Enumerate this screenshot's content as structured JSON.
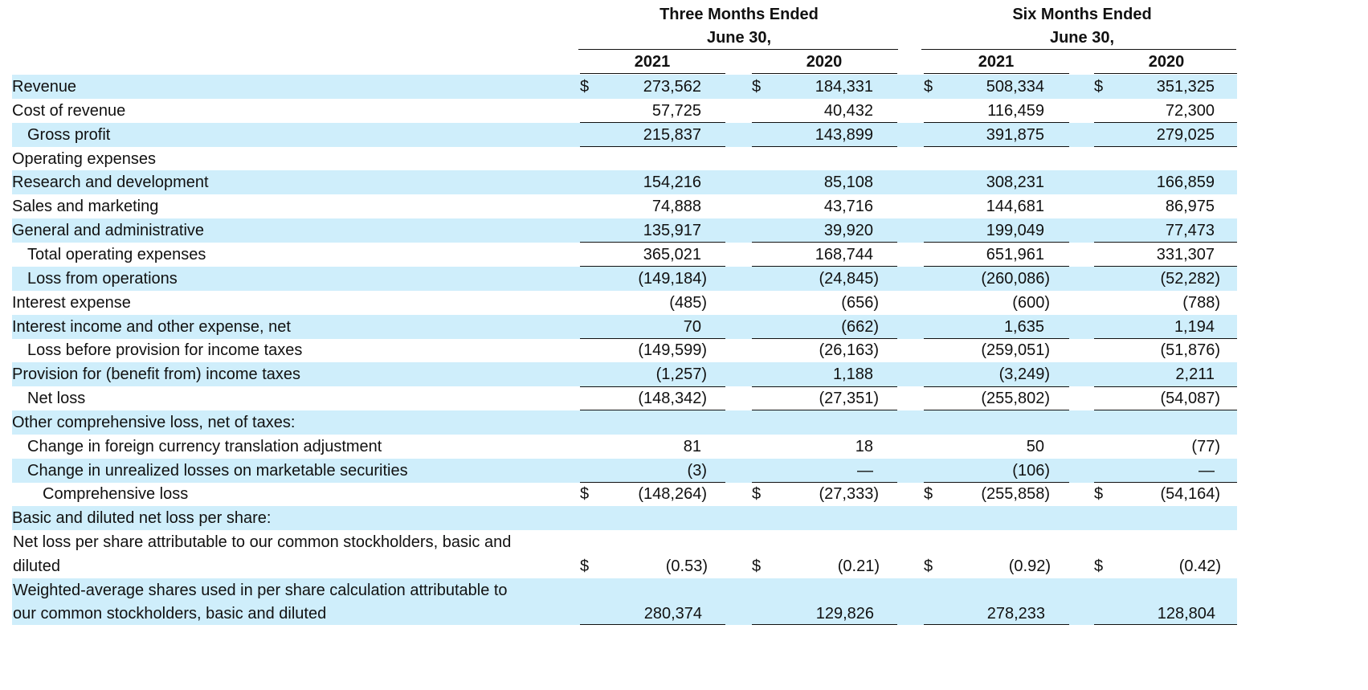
{
  "header": {
    "group1": [
      "Three Months Ended",
      "June 30,"
    ],
    "group2": [
      "Six Months Ended",
      "June 30,"
    ],
    "years": [
      "2021",
      "2020",
      "2021",
      "2020"
    ]
  },
  "currency_symbol": "$",
  "rows": [
    {
      "label": "Revenue",
      "values": [
        "273,562",
        "184,331",
        "508,334",
        "351,325"
      ]
    },
    {
      "label": "Cost of revenue",
      "values": [
        "57,725",
        "40,432",
        "116,459",
        "72,300"
      ]
    },
    {
      "label": "Gross profit",
      "values": [
        "215,837",
        "143,899",
        "391,875",
        "279,025"
      ]
    },
    {
      "label": "Operating expenses",
      "values": [
        "",
        "",
        "",
        ""
      ]
    },
    {
      "label": "Research and development",
      "values": [
        "154,216",
        "85,108",
        "308,231",
        "166,859"
      ]
    },
    {
      "label": "Sales and marketing",
      "values": [
        "74,888",
        "43,716",
        "144,681",
        "86,975"
      ]
    },
    {
      "label": "General and administrative",
      "values": [
        "135,917",
        "39,920",
        "199,049",
        "77,473"
      ]
    },
    {
      "label": "Total operating expenses",
      "values": [
        "365,021",
        "168,744",
        "651,961",
        "331,307"
      ]
    },
    {
      "label": "Loss from operations",
      "values": [
        "(149,184)",
        "(24,845)",
        "(260,086)",
        "(52,282)"
      ]
    },
    {
      "label": "Interest expense",
      "values": [
        "(485)",
        "(656)",
        "(600)",
        "(788)"
      ]
    },
    {
      "label": "Interest income and other expense, net",
      "values": [
        "70",
        "(662)",
        "1,635",
        "1,194"
      ]
    },
    {
      "label": "Loss before provision for income taxes",
      "values": [
        "(149,599)",
        "(26,163)",
        "(259,051)",
        "(51,876)"
      ]
    },
    {
      "label": "Provision for (benefit from) income taxes",
      "values": [
        "(1,257)",
        "1,188",
        "(3,249)",
        "2,211"
      ]
    },
    {
      "label": "Net loss",
      "values": [
        "(148,342)",
        "(27,351)",
        "(255,802)",
        "(54,087)"
      ]
    },
    {
      "label": "Other comprehensive loss, net of taxes:",
      "values": [
        "",
        "",
        "",
        ""
      ]
    },
    {
      "label": "Change in foreign currency translation adjustment",
      "values": [
        "81",
        "18",
        "50",
        "(77)"
      ]
    },
    {
      "label": "Change in unrealized losses on marketable securities",
      "values": [
        "(3)",
        "—",
        "(106)",
        "—"
      ]
    },
    {
      "label": "Comprehensive loss",
      "values": [
        "(148,264)",
        "(27,333)",
        "(255,858)",
        "(54,164)"
      ]
    },
    {
      "label": "Basic and diluted net loss per share:",
      "values": [
        "",
        "",
        "",
        ""
      ]
    }
  ],
  "eps_row": {
    "label_line1": "Net loss per share attributable to our common stockholders, basic and",
    "label_line2": "diluted",
    "values": [
      "(0.53)",
      "(0.21)",
      "(0.92)",
      "(0.42)"
    ]
  },
  "shares_row": {
    "label_line1": "Weighted-average shares used in per share calculation attributable to",
    "label_line2": "our common stockholders, basic and diluted",
    "values": [
      "280,374",
      "129,826",
      "278,233",
      "128,804"
    ]
  }
}
